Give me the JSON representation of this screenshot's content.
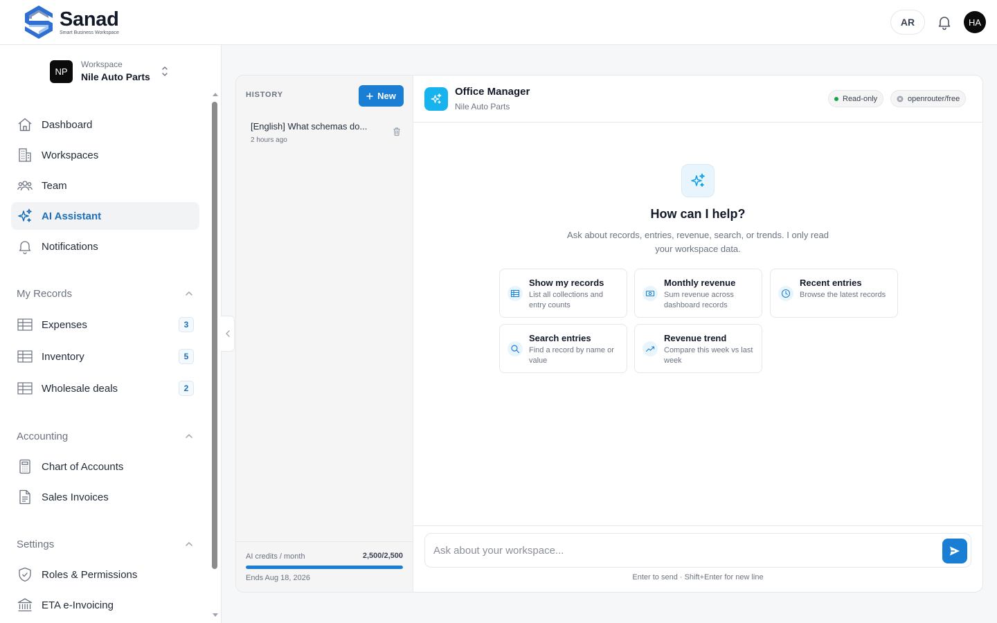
{
  "header": {
    "brand_name": "Sanad",
    "brand_tagline": "Smart Business Workspace",
    "lang_button": "AR",
    "avatar_initials": "HA"
  },
  "sidebar": {
    "workspace": {
      "badge": "NP",
      "label": "Workspace",
      "name": "Nile Auto Parts"
    },
    "nav": [
      {
        "label": "Dashboard",
        "icon": "home-icon"
      },
      {
        "label": "Workspaces",
        "icon": "building-icon"
      },
      {
        "label": "Team",
        "icon": "team-icon"
      },
      {
        "label": "AI Assistant",
        "icon": "sparkles-icon",
        "active": true
      },
      {
        "label": "Notifications",
        "icon": "bell-icon"
      }
    ],
    "sections": [
      {
        "label": "My Records",
        "items": [
          {
            "label": "Expenses",
            "count": "3"
          },
          {
            "label": "Inventory",
            "count": "5"
          },
          {
            "label": "Wholesale deals",
            "count": "2"
          }
        ]
      },
      {
        "label": "Accounting",
        "items": [
          {
            "label": "Chart of Accounts"
          },
          {
            "label": "Sales Invoices"
          }
        ]
      },
      {
        "label": "Settings",
        "items": [
          {
            "label": "Roles & Permissions"
          },
          {
            "label": "ETA e-Invoicing"
          }
        ]
      }
    ]
  },
  "history": {
    "title": "HISTORY",
    "new_label": "New",
    "items": [
      {
        "title": "[English] What schemas do...",
        "time": "2 hours ago"
      }
    ],
    "credits": {
      "label": "AI credits / month",
      "value": "2,500/2,500",
      "ends": "Ends Aug 18, 2026",
      "fraction": 1.0
    }
  },
  "chat": {
    "agent_name": "Office Manager",
    "agent_sub": "Nile Auto Parts",
    "badges": {
      "mode": "Read-only",
      "model": "openrouter/free"
    },
    "welcome_title": "How can I help?",
    "welcome_sub": "Ask about records, entries, revenue, search, or trends. I only read your workspace data.",
    "suggestions": [
      {
        "title": "Show my records",
        "desc": "List all collections and entry counts",
        "icon": "table-icon"
      },
      {
        "title": "Monthly revenue",
        "desc": "Sum revenue across dashboard records",
        "icon": "money-icon"
      },
      {
        "title": "Recent entries",
        "desc": "Browse the latest records",
        "icon": "clock-icon"
      },
      {
        "title": "Search entries",
        "desc": "Find a record by name or value",
        "icon": "search-icon"
      },
      {
        "title": "Revenue trend",
        "desc": "Compare this week vs last week",
        "icon": "trend-icon"
      }
    ],
    "input_placeholder": "Ask about your workspace...",
    "hint": "Enter to send · Shift+Enter for new line"
  },
  "colors": {
    "accent": "#1a7fd4",
    "agent": "#17b3ef",
    "active_nav_text": "#1d6fb8",
    "status_green": "#16a34a"
  }
}
